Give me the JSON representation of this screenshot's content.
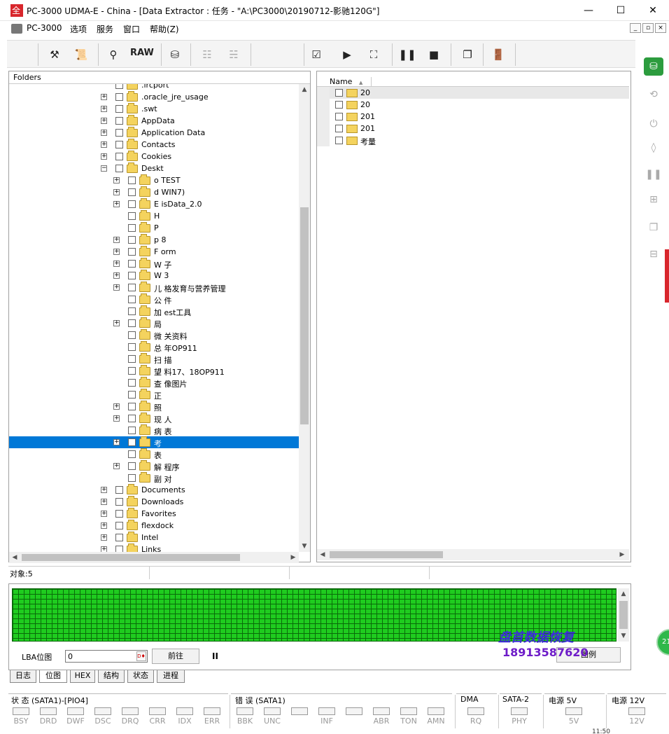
{
  "window": {
    "title": "PC-3000 UDMA-E - China - [Data Extractor : 任务 - \"A:\\PC3000\\20190712-影驰120G\"]",
    "minimize": "—",
    "maximize": "☐",
    "close": "✕"
  },
  "menu": {
    "items": [
      "PC-3000",
      "选项",
      "服务",
      "窗口",
      "帮助(Z)"
    ],
    "mdi": [
      "_",
      "▫",
      "×"
    ]
  },
  "toolbar": {
    "raw_label": "RAW",
    "icons": [
      "tools-icon",
      "scroll-icon",
      "binoculars-icon",
      "raw-button",
      "disk-icon",
      "tree-icon",
      "tree-map-icon",
      "check-icon",
      "play-icon",
      "tree-flow-icon",
      "pause-icon",
      "stop-icon",
      "copy-icon",
      "exit-icon"
    ]
  },
  "folders": {
    "header": "Folders",
    "rows": [
      {
        "label": ".ircport",
        "level": 1,
        "expand": false
      },
      {
        "label": ".oracle_jre_usage",
        "level": 1,
        "expand": true
      },
      {
        "label": ".swt",
        "level": 1,
        "expand": true
      },
      {
        "label": "AppData",
        "level": 1,
        "expand": true
      },
      {
        "label": "Application Data",
        "level": 1,
        "expand": true
      },
      {
        "label": "Contacts",
        "level": 1,
        "expand": true
      },
      {
        "label": "Cookies",
        "level": 1,
        "expand": true
      },
      {
        "label": "Deskt",
        "level": 1,
        "expand": true,
        "open": true
      },
      {
        "label": "o        TEST",
        "level": 2,
        "expand": true
      },
      {
        "label": "d        WIN7)",
        "level": 2,
        "expand": true
      },
      {
        "label": "E        isData_2.0",
        "level": 2,
        "expand": true
      },
      {
        "label": "H",
        "level": 2,
        "expand": false
      },
      {
        "label": "P",
        "level": 2,
        "expand": false
      },
      {
        "label": "p        8",
        "level": 2,
        "expand": true
      },
      {
        "label": "F        orm",
        "level": 2,
        "expand": true
      },
      {
        "label": "W        子",
        "level": 2,
        "expand": true
      },
      {
        "label": "W        3",
        "level": 2,
        "expand": true
      },
      {
        "label": "儿        格发育与营养管理",
        "level": 2,
        "expand": true
      },
      {
        "label": "公        件",
        "level": 2,
        "expand": false
      },
      {
        "label": "加        est工具",
        "level": 2,
        "expand": false
      },
      {
        "label": "局",
        "level": 2,
        "expand": true
      },
      {
        "label": "微        关资料",
        "level": 2,
        "expand": false
      },
      {
        "label": "总        年OP911",
        "level": 2,
        "expand": false
      },
      {
        "label": "扫        描",
        "level": 2,
        "expand": false
      },
      {
        "label": "望        料17、18OP911",
        "level": 2,
        "expand": false
      },
      {
        "label": "查        像图片",
        "level": 2,
        "expand": false
      },
      {
        "label": "正",
        "level": 2,
        "expand": false
      },
      {
        "label": "照",
        "level": 2,
        "expand": true
      },
      {
        "label": "现        人",
        "level": 2,
        "expand": true
      },
      {
        "label": "病        表",
        "level": 2,
        "expand": false
      },
      {
        "label": "考",
        "level": 2,
        "expand": true,
        "selected": true
      },
      {
        "label": "表",
        "level": 2,
        "expand": false
      },
      {
        "label": "解        程序",
        "level": 2,
        "expand": true
      },
      {
        "label": "副        对",
        "level": 2,
        "expand": false
      },
      {
        "label": "Documents",
        "level": 1,
        "expand": true
      },
      {
        "label": "Downloads",
        "level": 1,
        "expand": true
      },
      {
        "label": "Favorites",
        "level": 1,
        "expand": true
      },
      {
        "label": "flexdock",
        "level": 1,
        "expand": true
      },
      {
        "label": "Intel",
        "level": 1,
        "expand": true
      },
      {
        "label": "Links",
        "level": 1,
        "expand": true
      }
    ]
  },
  "files": {
    "column_name": "Name",
    "sort_glyph": "▲",
    "rows": [
      {
        "label": "20",
        "selected": true
      },
      {
        "label": "20"
      },
      {
        "label": "201"
      },
      {
        "label": "201"
      },
      {
        "label": "考量"
      }
    ]
  },
  "status_line": {
    "objects": "对象:5"
  },
  "bitmap": {
    "lba_label": "LBA位图",
    "lba_value": "0",
    "lba_btn": "D♦",
    "goto_label": "前往",
    "pause_glyph": "II",
    "legend_label": "图例",
    "watermark": "盘首数据恢复",
    "phone": "18913587620"
  },
  "tabs": [
    "日志",
    "位图",
    "HEX",
    "结构",
    "状态",
    "进程"
  ],
  "status_groups": {
    "status_title": "状 态 (SATA1)-[PIO4]",
    "status_leds": [
      "BSY",
      "DRD",
      "DWF",
      "DSC",
      "DRQ",
      "CRR",
      "IDX",
      "ERR"
    ],
    "error_title": "错 误 (SATA1)",
    "error_leds": [
      "BBK",
      "UNC",
      "",
      "INF",
      "",
      "ABR",
      "TON",
      "AMN"
    ],
    "dma_title": "DMA",
    "dma_led": "RQ",
    "sata_title": "SATA-2",
    "sata_led": "PHY",
    "p5_title": "电源 5V",
    "p5_led": "5V",
    "p12_title": "电源 12V",
    "p12_led": "12V"
  },
  "clock": "11:50",
  "green_badge": "21"
}
